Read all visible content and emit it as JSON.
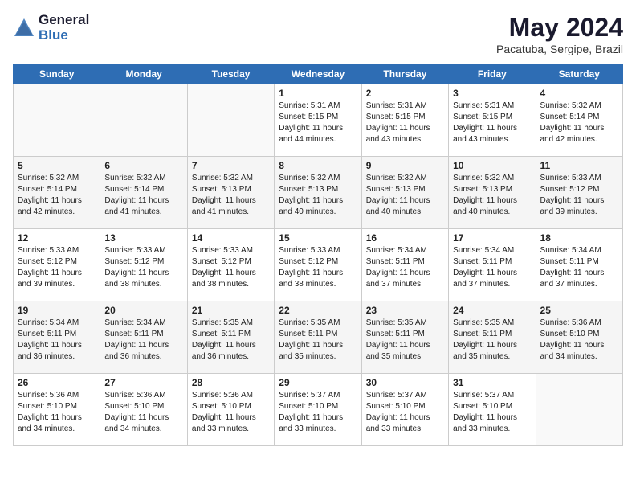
{
  "logo": {
    "line1": "General",
    "line2": "Blue"
  },
  "title": "May 2024",
  "location": "Pacatuba, Sergipe, Brazil",
  "days_header": [
    "Sunday",
    "Monday",
    "Tuesday",
    "Wednesday",
    "Thursday",
    "Friday",
    "Saturday"
  ],
  "weeks": [
    [
      {
        "num": "",
        "info": ""
      },
      {
        "num": "",
        "info": ""
      },
      {
        "num": "",
        "info": ""
      },
      {
        "num": "1",
        "info": "Sunrise: 5:31 AM\nSunset: 5:15 PM\nDaylight: 11 hours\nand 44 minutes."
      },
      {
        "num": "2",
        "info": "Sunrise: 5:31 AM\nSunset: 5:15 PM\nDaylight: 11 hours\nand 43 minutes."
      },
      {
        "num": "3",
        "info": "Sunrise: 5:31 AM\nSunset: 5:15 PM\nDaylight: 11 hours\nand 43 minutes."
      },
      {
        "num": "4",
        "info": "Sunrise: 5:32 AM\nSunset: 5:14 PM\nDaylight: 11 hours\nand 42 minutes."
      }
    ],
    [
      {
        "num": "5",
        "info": "Sunrise: 5:32 AM\nSunset: 5:14 PM\nDaylight: 11 hours\nand 42 minutes."
      },
      {
        "num": "6",
        "info": "Sunrise: 5:32 AM\nSunset: 5:14 PM\nDaylight: 11 hours\nand 41 minutes."
      },
      {
        "num": "7",
        "info": "Sunrise: 5:32 AM\nSunset: 5:13 PM\nDaylight: 11 hours\nand 41 minutes."
      },
      {
        "num": "8",
        "info": "Sunrise: 5:32 AM\nSunset: 5:13 PM\nDaylight: 11 hours\nand 40 minutes."
      },
      {
        "num": "9",
        "info": "Sunrise: 5:32 AM\nSunset: 5:13 PM\nDaylight: 11 hours\nand 40 minutes."
      },
      {
        "num": "10",
        "info": "Sunrise: 5:32 AM\nSunset: 5:13 PM\nDaylight: 11 hours\nand 40 minutes."
      },
      {
        "num": "11",
        "info": "Sunrise: 5:33 AM\nSunset: 5:12 PM\nDaylight: 11 hours\nand 39 minutes."
      }
    ],
    [
      {
        "num": "12",
        "info": "Sunrise: 5:33 AM\nSunset: 5:12 PM\nDaylight: 11 hours\nand 39 minutes."
      },
      {
        "num": "13",
        "info": "Sunrise: 5:33 AM\nSunset: 5:12 PM\nDaylight: 11 hours\nand 38 minutes."
      },
      {
        "num": "14",
        "info": "Sunrise: 5:33 AM\nSunset: 5:12 PM\nDaylight: 11 hours\nand 38 minutes."
      },
      {
        "num": "15",
        "info": "Sunrise: 5:33 AM\nSunset: 5:12 PM\nDaylight: 11 hours\nand 38 minutes."
      },
      {
        "num": "16",
        "info": "Sunrise: 5:34 AM\nSunset: 5:11 PM\nDaylight: 11 hours\nand 37 minutes."
      },
      {
        "num": "17",
        "info": "Sunrise: 5:34 AM\nSunset: 5:11 PM\nDaylight: 11 hours\nand 37 minutes."
      },
      {
        "num": "18",
        "info": "Sunrise: 5:34 AM\nSunset: 5:11 PM\nDaylight: 11 hours\nand 37 minutes."
      }
    ],
    [
      {
        "num": "19",
        "info": "Sunrise: 5:34 AM\nSunset: 5:11 PM\nDaylight: 11 hours\nand 36 minutes."
      },
      {
        "num": "20",
        "info": "Sunrise: 5:34 AM\nSunset: 5:11 PM\nDaylight: 11 hours\nand 36 minutes."
      },
      {
        "num": "21",
        "info": "Sunrise: 5:35 AM\nSunset: 5:11 PM\nDaylight: 11 hours\nand 36 minutes."
      },
      {
        "num": "22",
        "info": "Sunrise: 5:35 AM\nSunset: 5:11 PM\nDaylight: 11 hours\nand 35 minutes."
      },
      {
        "num": "23",
        "info": "Sunrise: 5:35 AM\nSunset: 5:11 PM\nDaylight: 11 hours\nand 35 minutes."
      },
      {
        "num": "24",
        "info": "Sunrise: 5:35 AM\nSunset: 5:11 PM\nDaylight: 11 hours\nand 35 minutes."
      },
      {
        "num": "25",
        "info": "Sunrise: 5:36 AM\nSunset: 5:10 PM\nDaylight: 11 hours\nand 34 minutes."
      }
    ],
    [
      {
        "num": "26",
        "info": "Sunrise: 5:36 AM\nSunset: 5:10 PM\nDaylight: 11 hours\nand 34 minutes."
      },
      {
        "num": "27",
        "info": "Sunrise: 5:36 AM\nSunset: 5:10 PM\nDaylight: 11 hours\nand 34 minutes."
      },
      {
        "num": "28",
        "info": "Sunrise: 5:36 AM\nSunset: 5:10 PM\nDaylight: 11 hours\nand 33 minutes."
      },
      {
        "num": "29",
        "info": "Sunrise: 5:37 AM\nSunset: 5:10 PM\nDaylight: 11 hours\nand 33 minutes."
      },
      {
        "num": "30",
        "info": "Sunrise: 5:37 AM\nSunset: 5:10 PM\nDaylight: 11 hours\nand 33 minutes."
      },
      {
        "num": "31",
        "info": "Sunrise: 5:37 AM\nSunset: 5:10 PM\nDaylight: 11 hours\nand 33 minutes."
      },
      {
        "num": "",
        "info": ""
      }
    ]
  ]
}
